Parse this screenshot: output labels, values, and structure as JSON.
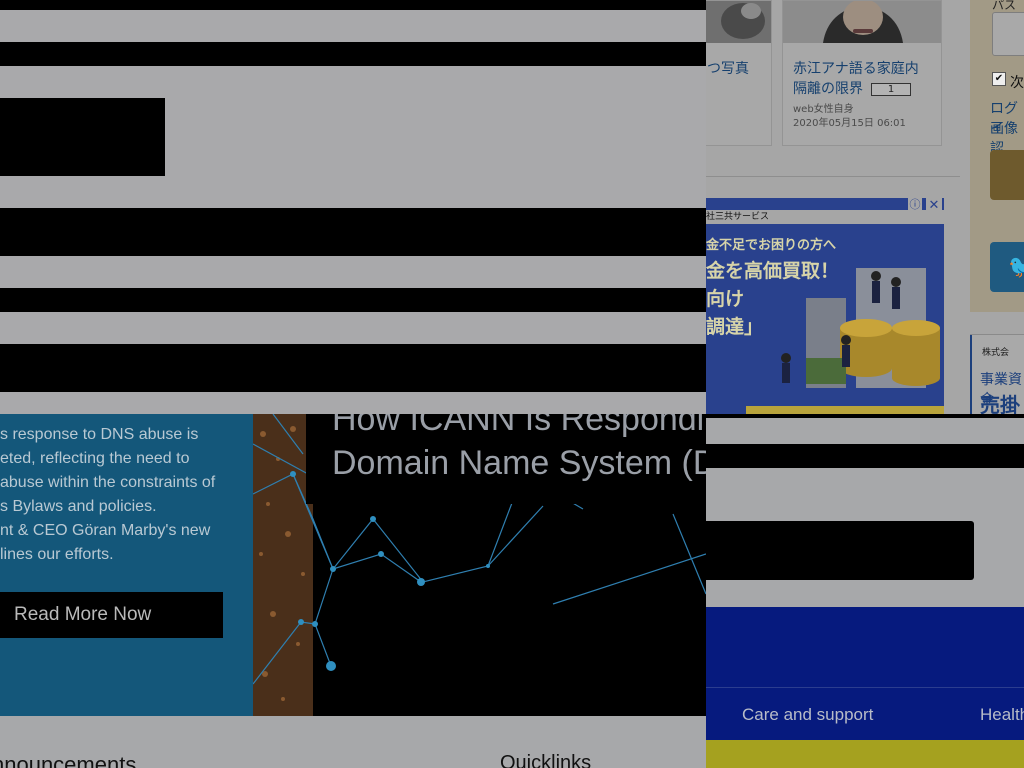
{
  "jp_portal": {
    "cards": [
      {
        "title_lines": [
          "つ写真"
        ]
      },
      {
        "title_lines": [
          "赤江アナ語る家庭内",
          "隔離の限界"
        ],
        "badge": "1",
        "source": "web女性自身",
        "timestamp": "2020年05月15日 06:01"
      }
    ],
    "ad": {
      "company": "社三共サービス",
      "lines": [
        "金不足でお困りの方へ",
        "金を高価買取！",
        "向け",
        "調達」"
      ]
    },
    "side": {
      "password_label": "パスワ",
      "remember_label": "次",
      "links": [
        "ログイ",
        "画像認"
      ],
      "company_short": "株式会",
      "ad2_lines": [
        "事業資金",
        "売掛"
      ]
    }
  },
  "icann": {
    "body_lines": [
      "s response to DNS abuse is",
      "eted, reflecting the need to",
      " abuse within the constraints of",
      "s Bylaws and policies.",
      "nt & CEO Göran Marby's new",
      "lines our efforts."
    ],
    "read_more": "Read More Now",
    "headline_lines": [
      "How ICANN Is Respondi",
      "Domain Name System (DN"
    ],
    "announcements_title": "nnouncements",
    "quicklinks_title": "Quicklinks"
  },
  "care_site": {
    "nav_items": [
      "Care and support",
      "Health"
    ]
  },
  "colors": {
    "icann_blue": "#14577a",
    "care_navy": "#061a7e",
    "care_yellow": "#a5a11f",
    "jp_link": "#16406e"
  }
}
